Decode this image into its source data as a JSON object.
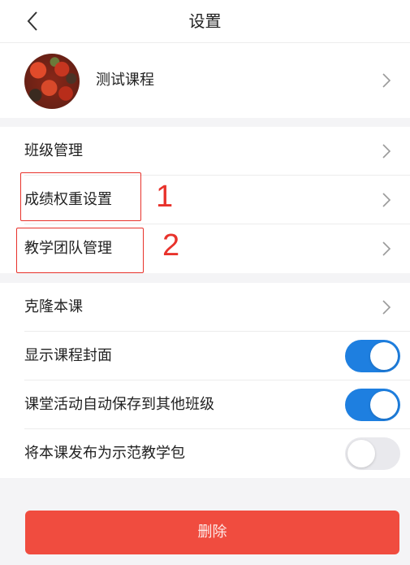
{
  "header": {
    "title": "设置"
  },
  "course": {
    "name": "测试课程"
  },
  "group1": {
    "items": [
      {
        "label": "班级管理"
      },
      {
        "label": "成绩权重设置"
      },
      {
        "label": "教学团队管理"
      }
    ]
  },
  "annotations": [
    {
      "number": "1"
    },
    {
      "number": "2"
    }
  ],
  "group2": {
    "items": [
      {
        "label": "克隆本课"
      },
      {
        "label": "显示课程封面",
        "toggle": true
      },
      {
        "label": "课堂活动自动保存到其他班级",
        "toggle": true
      },
      {
        "label": "将本课发布为示范教学包",
        "toggle": false
      }
    ]
  },
  "delete_label": "删除",
  "colors": {
    "accent": "#1e7fe0",
    "danger": "#f04c3f",
    "annotation": "#e8322b",
    "background": "#f4f4f6"
  },
  "icons": {
    "back": "chevron-left-icon",
    "row_arrow": "chevron-right-icon"
  }
}
